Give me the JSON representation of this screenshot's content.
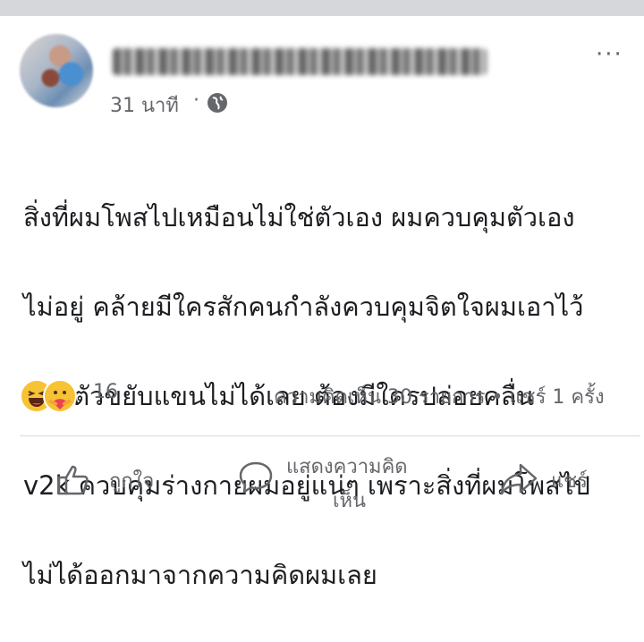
{
  "post": {
    "time": "31 นาที",
    "separator": "·",
    "more_label": "···",
    "body_lines": [
      "สิ่งที่ผมโพสไปเหมือนไม่ใช่ตัวเอง ผมควบคุมตัวเอง",
      "ไม่อยู่ คล้ายมีใครสักคนกำลังควบคุมจิตใจผมเอาไว้",
      "ขยับตัวขยับแขนไม่ได้เลย ต้องมีใครปล่อยคลื่น",
      "v2k ควบคุมร่างกายผมอยู่แน่ๆ เพราะสิ่งที่ผมโพสไป",
      "ไม่ได้ออกมาจากความคิดผมเลย"
    ]
  },
  "reactions": {
    "icons": [
      "haha-emoji",
      "care-emoji"
    ],
    "count": "16",
    "stats": "ความคิดเห็น 30 รายการ • แชร์ 1 ครั้ง"
  },
  "actions": {
    "like_label": "ถูกใจ",
    "comment_label_line1": "แสดงความคิด",
    "comment_label_line2": "เห็น",
    "share_label": "แชร์"
  },
  "colors": {
    "text": "#1c1e21",
    "secondary": "#65676b",
    "divider": "#d8dadf",
    "top_strip": "#d5d7db",
    "reaction_yellow": "#f7c334"
  }
}
